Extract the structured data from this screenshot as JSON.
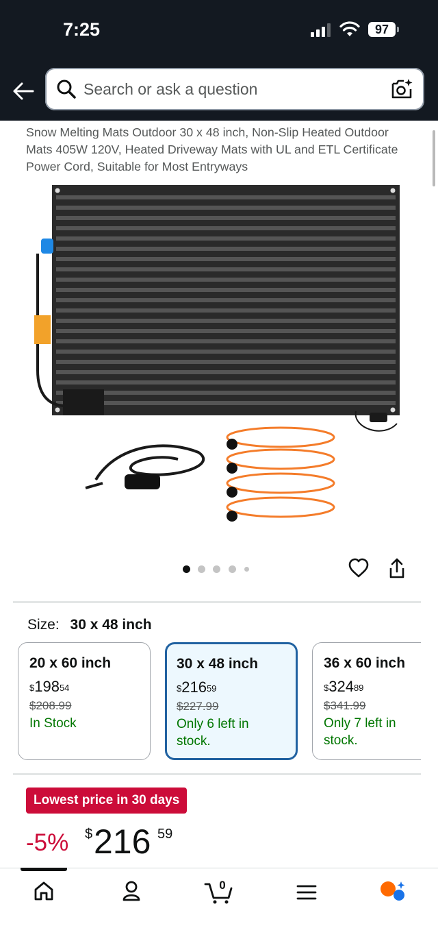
{
  "status_bar": {
    "time": "7:25",
    "battery": "97"
  },
  "search": {
    "placeholder": "Search or ask a question"
  },
  "product": {
    "title": "Snow Melting Mats Outdoor 30 x 48 inch, Non-Slip Heated Outdoor Mats 405W 120V, Heated Driveway Mats with UL and ETL Certificate Power Cord, Suitable for Most Entryways",
    "image_count": 5,
    "active_image": 1
  },
  "size": {
    "label": "Size:",
    "value": "30 x 48 inch"
  },
  "options": [
    {
      "name": "20 x 60 inch",
      "currency": "$",
      "whole": "198",
      "fraction": "54",
      "list_price": "$208.99",
      "stock": "In Stock"
    },
    {
      "name": "30 x 48 inch",
      "currency": "$",
      "whole": "216",
      "fraction": "59",
      "list_price": "$227.99",
      "stock": "Only 6 left in stock."
    },
    {
      "name": "36 x 60 inch",
      "currency": "$",
      "whole": "324",
      "fraction": "89",
      "list_price": "$341.99",
      "stock": "Only 7 left in stock."
    }
  ],
  "deal": {
    "badge": "Lowest price in 30 days",
    "discount": "-5%",
    "currency": "$",
    "whole": "216",
    "fraction": "59"
  },
  "cart": {
    "count": "0"
  },
  "colors": {
    "header": "#131921",
    "deal_red": "#cc0c39",
    "stock_green": "#007600",
    "selected_border": "#2162a1",
    "selected_bg": "#edf8fe"
  },
  "icons": [
    "back-arrow-icon",
    "search-icon",
    "camera-search-icon",
    "heart-icon",
    "share-icon",
    "home-icon",
    "account-icon",
    "cart-icon",
    "menu-icon",
    "rufus-icon"
  ]
}
